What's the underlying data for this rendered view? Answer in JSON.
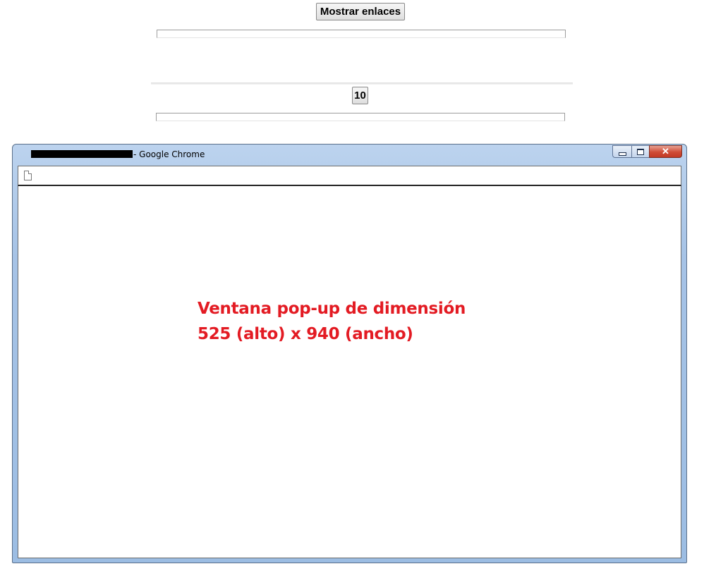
{
  "page": {
    "show_links_button": "Mostrar enlaces",
    "count_button": "10"
  },
  "popup": {
    "title_suffix": "- Google Chrome",
    "annotation_line1": "Ventana pop-up de dimensión",
    "annotation_line2": "525 (alto) x 940 (ancho)",
    "window_controls": {
      "close_label": "✕"
    },
    "icons": [
      "page-icon",
      "minimize-icon",
      "maximize-icon",
      "close-icon"
    ]
  },
  "colors": {
    "annotation": "#e31b23",
    "frame": "#a6c3e6",
    "close_button": "#cf4b35"
  }
}
